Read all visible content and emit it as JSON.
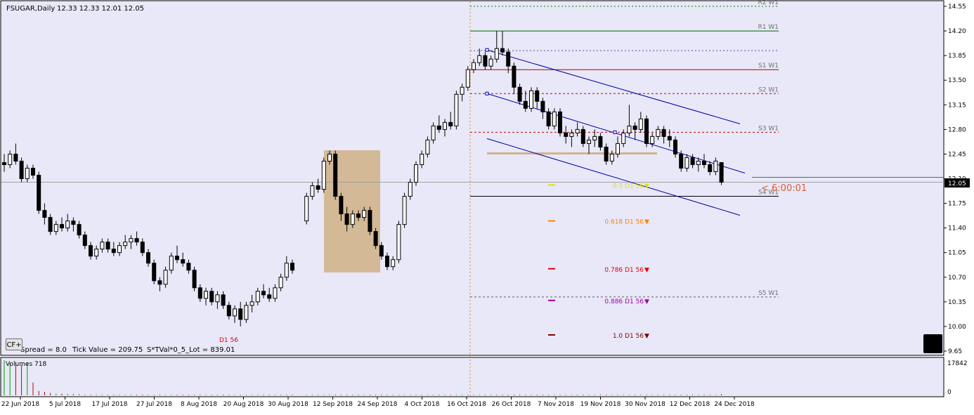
{
  "header": {
    "symbol_label": "FSUGAR,Daily",
    "ohlc_label": "12.33 12.33 12.01 12.05"
  },
  "info_bar": {
    "cf_button": "CF+",
    "spread_text": "Spread = 8.0",
    "tick_value_text": "Tick Value = 209.75",
    "lot_text": "S*TVal*0_5_Lot = 839.01"
  },
  "price_axis": {
    "ticks": [
      "14.55",
      "14.20",
      "13.85",
      "13.50",
      "13.15",
      "12.80",
      "12.45",
      "12.10",
      "11.75",
      "11.40",
      "11.05",
      "10.70",
      "10.35",
      "10.00",
      "9.65"
    ],
    "current_price": "12.05",
    "current_price_value": 12.05
  },
  "time_axis": {
    "labels": [
      "22 Jun 2018",
      "5 Jul 2018",
      "17 Jul 2018",
      "27 Jul 2018",
      "8 Aug 2018",
      "20 Aug 2018",
      "30 Aug 2018",
      "12 Sep 2018",
      "24 Sep 2018",
      "4 Oct 2018",
      "16 Oct 2018",
      "26 Oct 2018",
      "7 Nov 2018",
      "19 Nov 2018",
      "30 Nov 2018",
      "12 Dec 2018",
      "24 Dec 2018"
    ]
  },
  "pivot_levels": [
    {
      "label": "R2 W1",
      "value": 14.55,
      "color": "#008000",
      "style": "dotted"
    },
    {
      "label": "R1 W1",
      "value": 14.2,
      "color": "#006400",
      "style": "solid"
    },
    {
      "label": "",
      "value": 13.92,
      "color": "#5050a0",
      "style": "dotted"
    },
    {
      "label": "S1 W1",
      "value": 13.65,
      "color": "#b00000",
      "style": "solid"
    },
    {
      "label": "S2 W1",
      "value": 13.31,
      "color": "#c00000",
      "style": "dashed"
    },
    {
      "label": "S3 W1",
      "value": 12.76,
      "color": "#c00000",
      "style": "dashed"
    },
    {
      "label": "S4 W1",
      "value": 11.85,
      "color": "#000000",
      "style": "solid"
    },
    {
      "label": "S5 W1",
      "value": 10.42,
      "color": "#606060",
      "style": "dashed"
    }
  ],
  "countdown": "< 6:00:01",
  "fibonacci": [
    {
      "label": "0.5 D1 56",
      "arrow": "▼",
      "color": "#e0e000",
      "value": 12.01
    },
    {
      "label": "0.618 D1 56",
      "arrow": "▼",
      "color": "#ff8000",
      "value": 11.5
    },
    {
      "label": "0.786 D1 56",
      "arrow": "▼",
      "color": "#e00000",
      "value": 10.82
    },
    {
      "label": "0.886 D1 56",
      "arrow": "▼",
      "color": "#a000a0",
      "value": 10.37
    },
    {
      "label": "1.0 D1 56",
      "arrow": "▼",
      "color": "#800000",
      "value": 9.88
    }
  ],
  "swing_low_label": "D1 56",
  "volume_panel": {
    "title": "Volumes 718",
    "max_label": "17842",
    "zero_label": "0"
  },
  "colors": {
    "chart_background": "#e8e8f8",
    "bull_candle": "#ffffff",
    "bear_candle": "#000000",
    "channel": "#0000aa",
    "zone": "#d2b48c",
    "volume_up": "#00a000",
    "volume_down": "#c00000"
  },
  "chart_data": {
    "type": "candlestick",
    "y_range": [
      9.6,
      14.62
    ],
    "candles": [
      [
        12.33,
        12.45,
        12.2,
        12.3
      ],
      [
        12.3,
        12.5,
        12.25,
        12.45
      ],
      [
        12.45,
        12.6,
        12.3,
        12.35
      ],
      [
        12.35,
        12.4,
        12.05,
        12.1
      ],
      [
        12.1,
        12.3,
        12.05,
        12.25
      ],
      [
        12.25,
        12.3,
        12.1,
        12.15
      ],
      [
        12.15,
        12.2,
        11.6,
        11.65
      ],
      [
        11.65,
        11.75,
        11.45,
        11.55
      ],
      [
        11.55,
        11.6,
        11.3,
        11.35
      ],
      [
        11.35,
        11.5,
        11.3,
        11.45
      ],
      [
        11.45,
        11.55,
        11.35,
        11.4
      ],
      [
        11.4,
        11.6,
        11.35,
        11.5
      ],
      [
        11.5,
        11.55,
        11.35,
        11.45
      ],
      [
        11.45,
        11.5,
        11.25,
        11.3
      ],
      [
        11.3,
        11.35,
        11.1,
        11.15
      ],
      [
        11.15,
        11.2,
        10.95,
        11.0
      ],
      [
        11.0,
        11.15,
        10.95,
        11.1
      ],
      [
        11.1,
        11.25,
        11.05,
        11.2
      ],
      [
        11.2,
        11.25,
        11.05,
        11.1
      ],
      [
        11.1,
        11.2,
        11.0,
        11.05
      ],
      [
        11.05,
        11.2,
        11.0,
        11.15
      ],
      [
        11.15,
        11.3,
        11.1,
        11.2
      ],
      [
        11.2,
        11.3,
        11.1,
        11.25
      ],
      [
        11.25,
        11.35,
        11.15,
        11.2
      ],
      [
        11.2,
        11.25,
        11.0,
        11.05
      ],
      [
        11.05,
        11.1,
        10.85,
        10.9
      ],
      [
        10.9,
        10.95,
        10.6,
        10.65
      ],
      [
        10.65,
        10.7,
        10.5,
        10.6
      ],
      [
        10.6,
        10.85,
        10.55,
        10.8
      ],
      [
        10.8,
        11.05,
        10.75,
        11.0
      ],
      [
        11.0,
        11.15,
        10.9,
        10.95
      ],
      [
        10.95,
        11.05,
        10.85,
        10.9
      ],
      [
        10.9,
        10.95,
        10.75,
        10.8
      ],
      [
        10.8,
        10.85,
        10.5,
        10.55
      ],
      [
        10.55,
        10.6,
        10.35,
        10.4
      ],
      [
        10.4,
        10.55,
        10.3,
        10.5
      ],
      [
        10.5,
        10.55,
        10.3,
        10.35
      ],
      [
        10.35,
        10.5,
        10.25,
        10.45
      ],
      [
        10.45,
        10.5,
        10.25,
        10.3
      ],
      [
        10.3,
        10.35,
        10.1,
        10.15
      ],
      [
        10.15,
        10.3,
        10.05,
        10.25
      ],
      [
        10.25,
        10.35,
        10.0,
        10.1
      ],
      [
        10.1,
        10.35,
        10.05,
        10.3
      ],
      [
        10.3,
        10.45,
        10.2,
        10.35
      ],
      [
        10.35,
        10.55,
        10.3,
        10.5
      ],
      [
        10.5,
        10.6,
        10.4,
        10.45
      ],
      [
        10.45,
        10.55,
        10.35,
        10.4
      ],
      [
        10.4,
        10.6,
        10.35,
        10.55
      ],
      [
        10.55,
        10.75,
        10.5,
        10.7
      ],
      [
        10.7,
        11.0,
        10.65,
        10.9
      ],
      [
        10.9,
        10.95,
        10.75,
        10.8
      ],
      [
        11.5,
        11.9,
        11.45,
        11.85
      ],
      [
        11.85,
        12.05,
        11.8,
        12.0
      ],
      [
        12.0,
        12.1,
        11.9,
        11.95
      ],
      [
        11.95,
        12.4,
        11.9,
        12.35
      ],
      [
        12.35,
        12.5,
        12.3,
        12.45
      ],
      [
        12.45,
        12.5,
        11.8,
        11.85
      ],
      [
        11.85,
        11.9,
        11.5,
        11.6
      ],
      [
        11.6,
        11.7,
        11.35,
        11.45
      ],
      [
        11.45,
        11.65,
        11.4,
        11.6
      ],
      [
        11.6,
        11.65,
        11.5,
        11.55
      ],
      [
        11.55,
        11.7,
        11.5,
        11.65
      ],
      [
        11.65,
        11.7,
        11.3,
        11.35
      ],
      [
        11.35,
        11.4,
        11.1,
        11.15
      ],
      [
        11.15,
        11.2,
        10.95,
        11.0
      ],
      [
        11.0,
        11.05,
        10.8,
        10.85
      ],
      [
        10.85,
        11.0,
        10.8,
        10.95
      ],
      [
        10.95,
        11.5,
        10.9,
        11.45
      ],
      [
        11.45,
        11.9,
        11.4,
        11.85
      ],
      [
        11.85,
        12.1,
        11.8,
        12.05
      ],
      [
        12.05,
        12.35,
        12.0,
        12.3
      ],
      [
        12.3,
        12.5,
        12.25,
        12.45
      ],
      [
        12.45,
        12.7,
        12.4,
        12.65
      ],
      [
        12.65,
        12.9,
        12.6,
        12.85
      ],
      [
        12.85,
        13.0,
        12.75,
        12.8
      ],
      [
        12.8,
        12.95,
        12.7,
        12.9
      ],
      [
        12.9,
        13.05,
        12.8,
        12.85
      ],
      [
        12.85,
        13.35,
        12.8,
        13.3
      ],
      [
        13.3,
        13.45,
        13.2,
        13.4
      ],
      [
        13.4,
        13.7,
        13.35,
        13.65
      ],
      [
        13.65,
        13.8,
        13.6,
        13.75
      ],
      [
        13.75,
        13.95,
        13.7,
        13.85
      ],
      [
        13.85,
        13.9,
        13.65,
        13.7
      ],
      [
        13.7,
        13.85,
        13.65,
        13.8
      ],
      [
        13.8,
        14.2,
        13.75,
        13.95
      ],
      [
        13.95,
        14.2,
        13.85,
        13.9
      ],
      [
        13.9,
        13.95,
        13.6,
        13.7
      ],
      [
        13.7,
        13.75,
        13.3,
        13.4
      ],
      [
        13.4,
        13.45,
        13.15,
        13.2
      ],
      [
        13.2,
        13.35,
        13.05,
        13.1
      ],
      [
        13.1,
        13.4,
        13.05,
        13.35
      ],
      [
        13.35,
        13.4,
        13.1,
        13.2
      ],
      [
        13.2,
        13.25,
        12.95,
        13.05
      ],
      [
        13.05,
        13.1,
        12.8,
        12.85
      ],
      [
        12.85,
        13.1,
        12.8,
        13.05
      ],
      [
        13.05,
        13.1,
        12.7,
        12.75
      ],
      [
        12.75,
        12.85,
        12.6,
        12.7
      ],
      [
        12.7,
        12.8,
        12.55,
        12.75
      ],
      [
        12.75,
        12.9,
        12.7,
        12.8
      ],
      [
        12.8,
        12.85,
        12.55,
        12.6
      ],
      [
        12.6,
        12.7,
        12.45,
        12.65
      ],
      [
        12.65,
        12.8,
        12.55,
        12.7
      ],
      [
        12.7,
        12.75,
        12.5,
        12.55
      ],
      [
        12.55,
        12.6,
        12.3,
        12.35
      ],
      [
        12.35,
        12.5,
        12.3,
        12.45
      ],
      [
        12.45,
        12.7,
        12.4,
        12.6
      ],
      [
        12.6,
        12.8,
        12.55,
        12.75
      ],
      [
        12.75,
        13.15,
        12.7,
        12.85
      ],
      [
        12.85,
        12.9,
        12.65,
        12.8
      ],
      [
        12.8,
        13.05,
        12.75,
        12.95
      ],
      [
        12.95,
        13.0,
        12.55,
        12.6
      ],
      [
        12.6,
        12.75,
        12.55,
        12.7
      ],
      [
        12.7,
        12.85,
        12.65,
        12.8
      ],
      [
        12.8,
        12.85,
        12.6,
        12.7
      ],
      [
        12.7,
        12.8,
        12.55,
        12.65
      ],
      [
        12.65,
        12.7,
        12.4,
        12.45
      ],
      [
        12.45,
        12.5,
        12.2,
        12.25
      ],
      [
        12.25,
        12.45,
        12.2,
        12.4
      ],
      [
        12.4,
        12.45,
        12.25,
        12.3
      ],
      [
        12.3,
        12.4,
        12.2,
        12.35
      ],
      [
        12.35,
        12.45,
        12.25,
        12.3
      ],
      [
        12.3,
        12.35,
        12.15,
        12.2
      ],
      [
        12.2,
        12.4,
        12.15,
        12.35
      ],
      [
        12.33,
        12.33,
        12.01,
        12.05
      ]
    ],
    "volumes": [
      17842,
      16500,
      17000,
      15200,
      16800,
      6500,
      2200,
      1800,
      1200,
      900,
      800,
      700,
      650,
      500,
      400,
      350,
      300,
      280,
      300,
      250,
      200,
      180,
      160,
      150,
      140,
      130,
      120,
      110,
      100,
      100,
      90,
      90,
      80,
      80,
      70,
      70,
      60,
      60,
      60,
      50,
      50,
      50,
      50,
      50,
      40,
      40,
      40,
      40,
      40,
      40,
      40,
      40,
      40,
      40,
      40,
      40,
      40,
      40,
      40,
      40,
      40,
      40,
      40,
      40,
      40,
      40,
      40,
      40,
      40,
      40,
      40,
      40,
      40,
      40,
      40,
      40,
      40,
      40,
      40,
      40,
      40,
      40,
      40,
      40,
      40,
      40,
      40,
      40,
      40,
      40,
      40,
      40,
      40,
      40,
      40,
      40,
      40,
      40,
      40,
      40,
      40,
      40,
      40,
      40,
      40,
      40,
      40,
      40,
      40,
      40,
      40,
      40,
      40,
      40,
      40,
      40,
      40,
      40,
      40,
      40,
      40,
      40,
      40,
      718
    ]
  }
}
